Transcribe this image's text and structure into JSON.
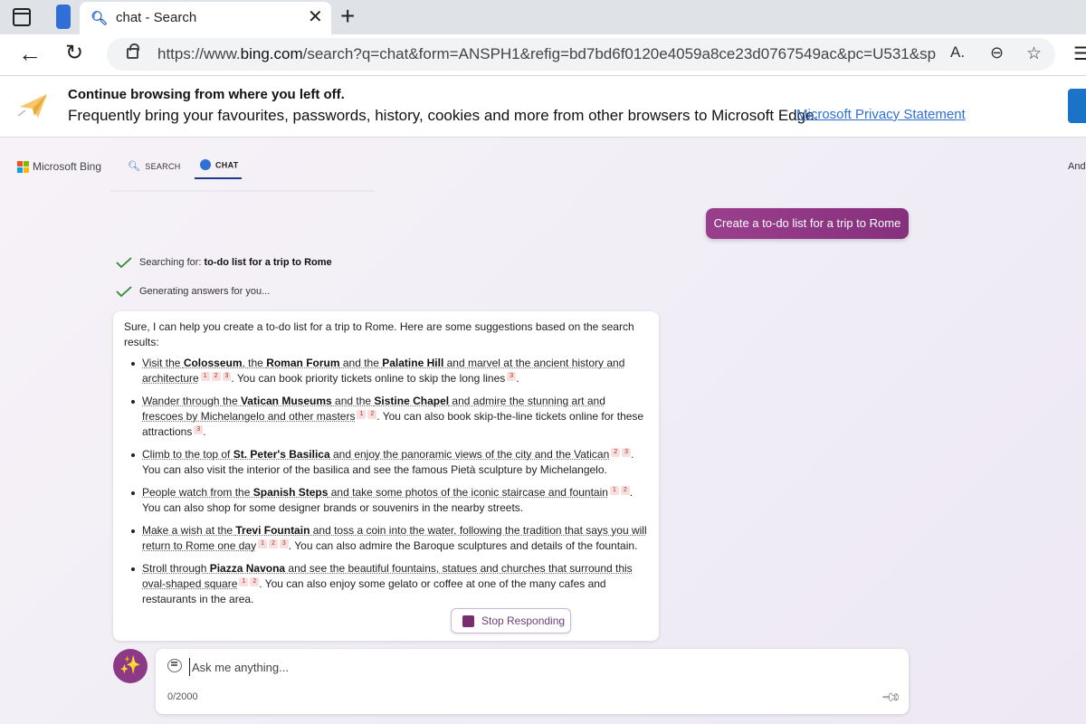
{
  "browser": {
    "tab": {
      "title": "chat - Search",
      "favicon": "search-icon",
      "close_glyph": "✕"
    },
    "new_tab_glyph": "+",
    "address": {
      "url_prefix": "https://www.",
      "url_domain": "bing.com",
      "url_rest": "/search?q=chat&form=ANSPH1&refig=bd7bd6f0120e4059a8ce23d0767549ac&pc=U531&sp..."
    }
  },
  "infobar": {
    "title": "Continue browsing from where you left off.",
    "body": "Frequently bring your favourites, passwords, history, cookies and more from other browsers to Microsoft Edge.",
    "link": "Microsoft Privacy Statement"
  },
  "bing": {
    "logo_text": "Microsoft Bing",
    "nav": {
      "search": "SEARCH",
      "chat": "CHAT"
    },
    "user": "Andi"
  },
  "chat": {
    "user_message": "Create a to-do list for a trip to Rome",
    "status": {
      "searching_prefix": "Searching for:",
      "searching_query": "to-do list for a trip to Rome",
      "generating": "Generating answers for you..."
    },
    "answer": {
      "intro": "Sure, I can help you create a to-do list for a trip to Rome. Here are some suggestions based on the search results:",
      "items": [
        {
          "a": "Visit the ",
          "b1": "Colosseum",
          "c": ", the ",
          "b2": "Roman Forum",
          "d": " and the ",
          "b3": "Palatine Hill",
          "e": " and marvel at the ancient history and architecture",
          "refs1": [
            "1",
            "2",
            "3"
          ],
          "tail": ". You can book priority tickets online to skip the long lines",
          "refs2": [
            "3"
          ],
          "end": "."
        },
        {
          "a": "Wander through the ",
          "b1": "Vatican Museums",
          "c": " and the ",
          "b2": "Sistine Chapel",
          "d": " and admire the stunning art and frescoes by Michelangelo and other masters",
          "b3": "",
          "e": "",
          "refs1": [
            "1",
            "2"
          ],
          "tail": ". You can also book skip-the-line tickets online for these attractions",
          "refs2": [
            "3"
          ],
          "end": "."
        },
        {
          "a": "Climb to the top of ",
          "b1": "St. Peter's Basilica",
          "c": " and enjoy the panoramic views of the city and the Vatican",
          "b2": "",
          "d": "",
          "b3": "",
          "e": "",
          "refs1": [
            "2",
            "3"
          ],
          "tail": ". You can also visit the interior of the basilica and see the famous Pietà sculpture by Michelangelo.",
          "refs2": [],
          "end": ""
        },
        {
          "a": "People watch from the ",
          "b1": "Spanish Steps",
          "c": " and take some photos of the iconic staircase and fountain",
          "b2": "",
          "d": "",
          "b3": "",
          "e": "",
          "refs1": [
            "1",
            "2"
          ],
          "tail": ". You can also shop for some designer brands or souvenirs in the nearby streets.",
          "refs2": [],
          "end": ""
        },
        {
          "a": "Make a wish at the ",
          "b1": "Trevi Fountain",
          "c": " and toss a coin into the water, following the tradition that says you will return to Rome one day",
          "b2": "",
          "d": "",
          "b3": "",
          "e": "",
          "refs1": [
            "1",
            "2",
            "3"
          ],
          "tail": ". You can also admire the Baroque sculptures and details of the fountain.",
          "refs2": [],
          "end": ""
        },
        {
          "a": "Stroll through ",
          "b1": "Piazza Navona",
          "c": " and see the beautiful fountains, statues and churches that surround this oval-shaped square",
          "b2": "",
          "d": "",
          "b3": "",
          "e": "",
          "refs1": [
            "1",
            "2"
          ],
          "tail": ". You can also enjoy some gelato or coffee at one of the many cafes and restaurants in the area.",
          "refs2": [],
          "end": ""
        }
      ]
    },
    "stop_button": "Stop Responding",
    "input": {
      "placeholder": "Ask me anything...",
      "char_count": "0/2000"
    }
  },
  "colors": {
    "accent_purple": "#86307d",
    "link_blue": "#2f6fd6",
    "check_green": "#2e8b3a",
    "ms_logo": [
      "#f25022",
      "#7fba00",
      "#00a4ef",
      "#ffb900"
    ]
  },
  "icons": [
    "tab-actions-icon",
    "vertical-tabs-icon",
    "search-icon",
    "close-icon",
    "back-icon",
    "reload-icon",
    "lock-icon",
    "read-aloud-icon",
    "zoom-icon",
    "add-favorite-icon",
    "paper-plane-icon",
    "chat-icon",
    "check-icon",
    "stop-icon",
    "broom-icon",
    "pin-icon"
  ]
}
